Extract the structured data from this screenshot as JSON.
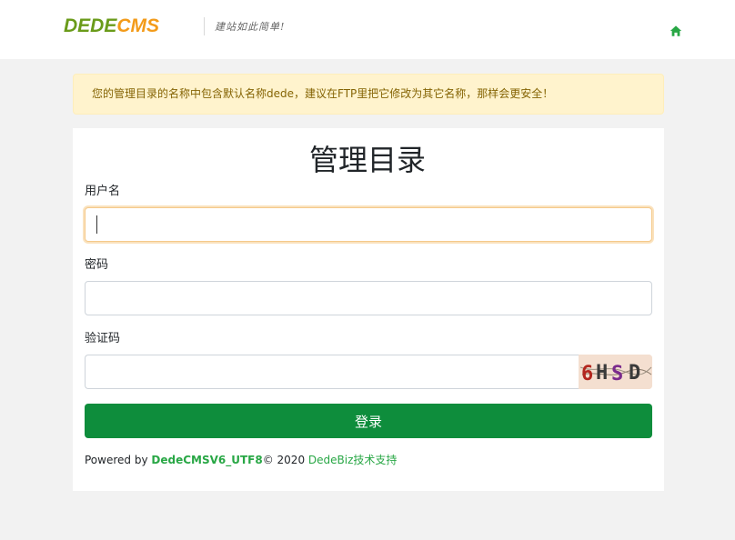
{
  "header": {
    "logo_dede": "DEDE",
    "logo_cms": "CMS",
    "slogan": "建站如此简单!",
    "home_icon": "home-icon"
  },
  "alert": {
    "message": "您的管理目录的名称中包含默认名称dede，建议在FTP里把它修改为其它名称，那样会更安全！"
  },
  "form": {
    "title": "管理目录",
    "username_label": "用户名",
    "username_value": "",
    "password_label": "密码",
    "password_value": "",
    "captcha_label": "验证码",
    "captcha_value": "",
    "captcha_text": "6HSD",
    "submit_label": "登录"
  },
  "footer": {
    "powered_by": "Powered by ",
    "version": "DedeCMSV6_UTF8",
    "copyright": "© 2020 ",
    "biz": "DedeBiz技术支持"
  },
  "colors": {
    "primary": "#0e8d3c",
    "link": "#28a745",
    "alert_bg": "#fff3cd",
    "alert_text": "#856404",
    "logo_green": "#6a9b1a",
    "logo_orange": "#f39b1a"
  }
}
